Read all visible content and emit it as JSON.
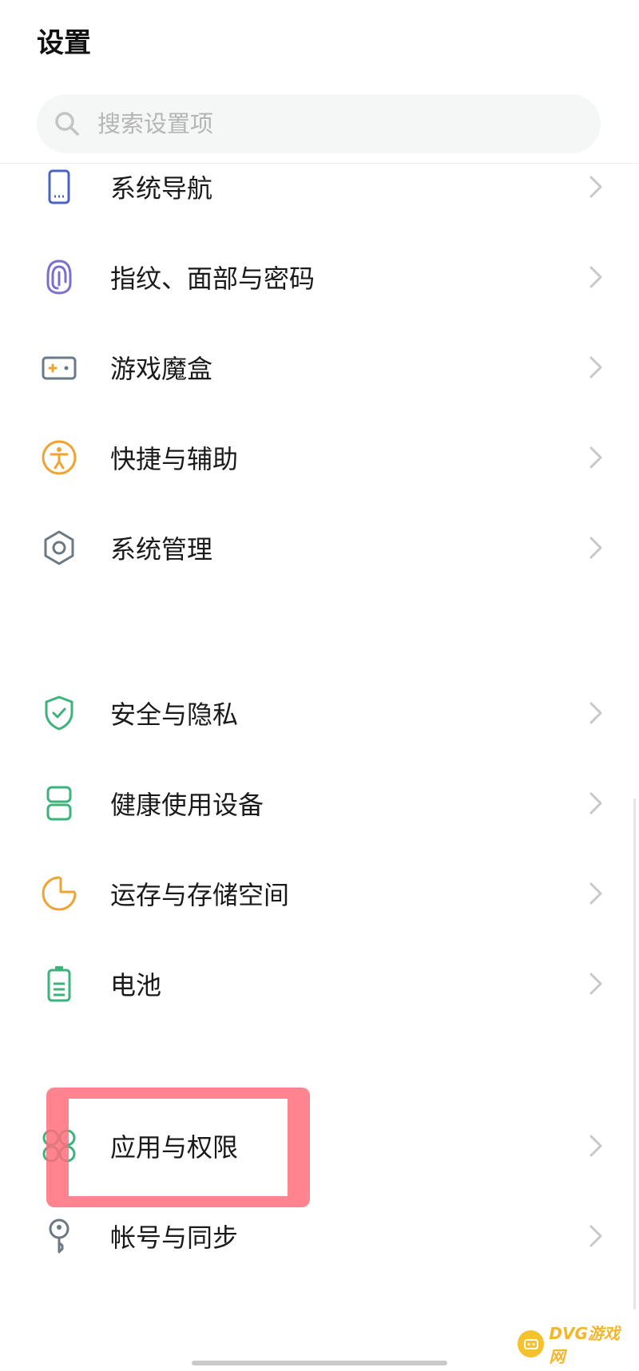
{
  "header": {
    "title": "设置"
  },
  "search": {
    "placeholder": "搜索设置项",
    "icon": "search-icon"
  },
  "items": [
    {
      "label": "系统导航",
      "icon": "phone-navigation-icon",
      "color": "#4a63c9"
    },
    {
      "label": "指纹、面部与密码",
      "icon": "fingerprint-icon",
      "color": "#7a6fd1"
    },
    {
      "label": "游戏魔盒",
      "icon": "gamepad-icon",
      "color": "#6a7a86"
    },
    {
      "label": "快捷与辅助",
      "icon": "accessibility-icon",
      "color": "#f0a330"
    },
    {
      "label": "系统管理",
      "icon": "hexagon-nut-icon",
      "color": "#6c7882"
    },
    {
      "label": "安全与隐私",
      "icon": "shield-check-icon",
      "color": "#3bb37a"
    },
    {
      "label": "健康使用设备",
      "icon": "hourglass-icon",
      "color": "#3bb37a"
    },
    {
      "label": "运存与存储空间",
      "icon": "pie-chart-icon",
      "color": "#f0a330"
    },
    {
      "label": "电池",
      "icon": "battery-icon",
      "color": "#3bb37a"
    },
    {
      "label": "应用与权限",
      "icon": "apps-grid-icon",
      "color": "#3bb37a"
    },
    {
      "label": "帐号与同步",
      "icon": "key-icon",
      "color": "#6c7882"
    }
  ],
  "highlight": {
    "target": "应用与权限",
    "color": "#ff6e7d"
  },
  "watermark": {
    "text": "DVG游戏网"
  }
}
